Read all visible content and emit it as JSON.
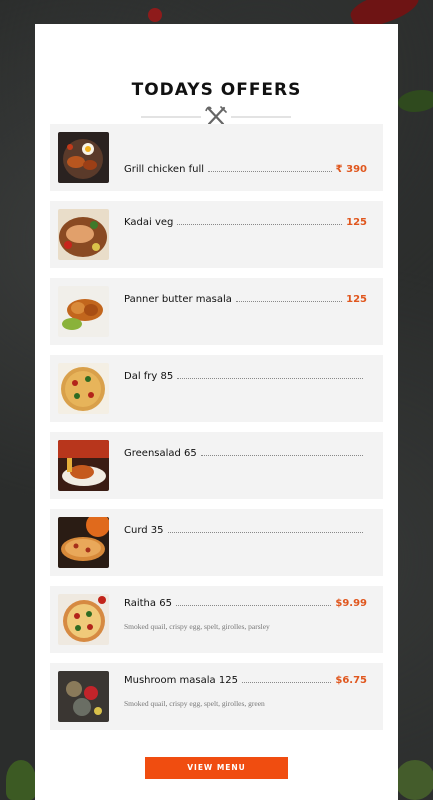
{
  "header": {
    "title": "TODAYS OFFERS"
  },
  "items": [
    {
      "name": "Grill chicken full",
      "price": "₹ 390",
      "desc": ""
    },
    {
      "name": "Kadai veg",
      "price": "125",
      "desc": ""
    },
    {
      "name": "Panner butter masala",
      "price": "125",
      "desc": ""
    },
    {
      "name": "Dal fry 85",
      "price": "",
      "desc": ""
    },
    {
      "name": "Greensalad 65",
      "price": "",
      "desc": ""
    },
    {
      "name": "Curd 35",
      "price": "",
      "desc": ""
    },
    {
      "name": "Raitha 65",
      "price": "$9.99",
      "desc": "Smoked quail, crispy egg, spelt, girolles, parsley"
    },
    {
      "name": "Mushroom masala 125",
      "price": "$6.75",
      "desc": "Smoked quail, crispy egg, spelt, girolles, green"
    }
  ],
  "cta": {
    "label": "VIEW MENU"
  },
  "colors": {
    "accent": "#f04d10",
    "price": "#e0571e",
    "item_bg": "#f3f3f3"
  },
  "icons": {
    "divider": "fork-knife-icon"
  }
}
